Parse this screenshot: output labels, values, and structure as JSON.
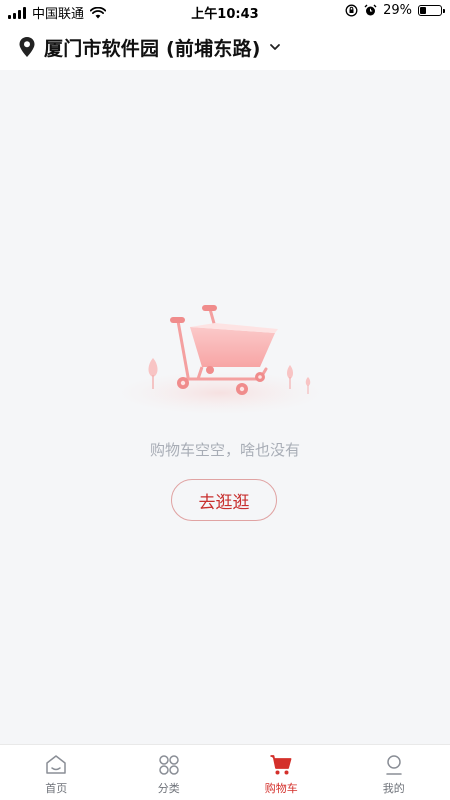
{
  "status_bar": {
    "carrier": "中国联通",
    "time": "上午10:43",
    "battery": "29%",
    "battery_level": 0.29
  },
  "header": {
    "location": "厦门市软件园 (前埔东路)"
  },
  "empty_state": {
    "message": "购物车空空，啥也没有",
    "button_label": "去逛逛"
  },
  "tabbar": {
    "tabs": [
      {
        "label": "首页",
        "icon": "home-icon",
        "active": false
      },
      {
        "label": "分类",
        "icon": "category-icon",
        "active": false
      },
      {
        "label": "购物车",
        "icon": "cart-icon",
        "active": true
      },
      {
        "label": "我的",
        "icon": "profile-icon",
        "active": false
      }
    ]
  },
  "colors": {
    "accent": "#d4302b",
    "background": "#f5f6f8",
    "muted_text": "#a8adb6"
  }
}
